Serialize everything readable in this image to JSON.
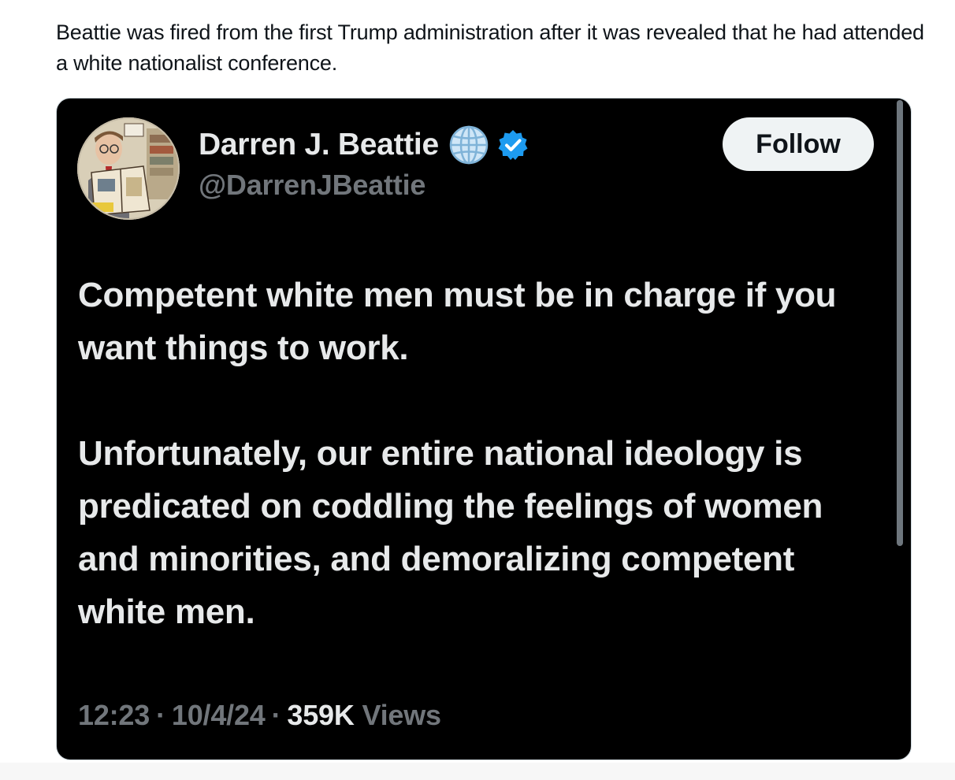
{
  "caption": "Beattie was fired from the first Trump administration after it was revealed that he had attended a white nationalist conference.",
  "tweet": {
    "author": {
      "display_name": "Darren J. Beattie",
      "handle": "@DarrenJBeattie",
      "badges": [
        "globe-icon",
        "verified-icon"
      ],
      "verified_color": "#1d9bf0"
    },
    "follow_label": "Follow",
    "paragraphs": [
      "Competent white men must be in charge if you want things to work.",
      "Unfortunately, our entire national ideology is predicated on coddling the feelings of women and minorities, and demoralizing competent white men."
    ],
    "time": "12:23",
    "separator": "·",
    "date": "10/4/24",
    "views_count": "359K",
    "views_label": "Views"
  },
  "colors": {
    "card_background": "#000000",
    "primary_text": "#e7e9ea",
    "secondary_text": "#71767b",
    "follow_button_bg": "#eff3f4"
  }
}
